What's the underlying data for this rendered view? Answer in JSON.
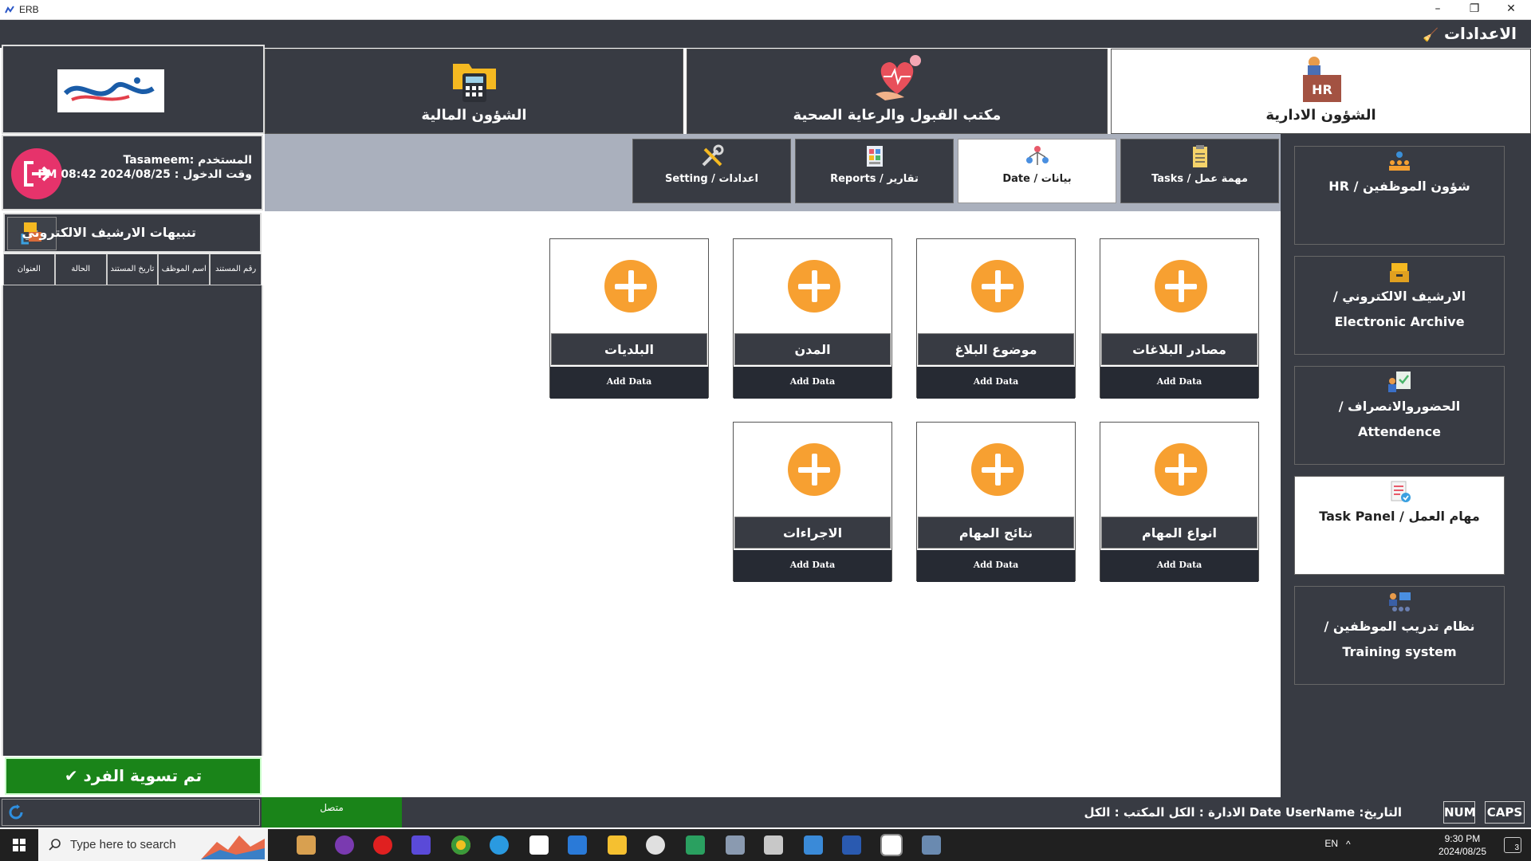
{
  "window": {
    "title": "ERB"
  },
  "settings_bar": {
    "label": "الاعدادات"
  },
  "modules": [
    {
      "label": "الشؤون الادارية",
      "icon": "hr-icon",
      "active": true
    },
    {
      "label": "مكتب القبول والرعاية الصحية",
      "icon": "health-care-icon",
      "active": false
    },
    {
      "label": "الشؤون المالية",
      "icon": "calculator-folder-icon",
      "active": false
    }
  ],
  "user": {
    "line1": "المستخدم :Tasameem",
    "line2": "وقت الدخول : 2024/08/25 PM 08:42"
  },
  "archive_alerts": {
    "title": "تنبيهات الارشيف الالكتروني",
    "columns": [
      "رقم المستند",
      "اسم الموظف",
      "تاريخ المستند",
      "الحالة",
      "العنوان"
    ]
  },
  "settle_button": "تم تسوية الفرد",
  "sub_tabs": [
    {
      "label": "مهمة عمل / Tasks",
      "icon": "clipboard-icon",
      "active": false
    },
    {
      "label": "بيانات / Date",
      "icon": "data-network-icon",
      "active": true
    },
    {
      "label": "تقارير / Reports",
      "icon": "report-icon",
      "active": false
    },
    {
      "label": "اعدادات / Setting",
      "icon": "tools-icon",
      "active": false
    }
  ],
  "cards_row1": [
    {
      "name": "مصادر البلاغات",
      "action": "Add Data"
    },
    {
      "name": "موضوع البلاغ",
      "action": "Add Data"
    },
    {
      "name": "المدن",
      "action": "Add Data"
    },
    {
      "name": "البلديات",
      "action": "Add Data"
    }
  ],
  "cards_row2": [
    {
      "name": "انواع المهام",
      "action": "Add Data"
    },
    {
      "name": "نتائج المهام",
      "action": "Add Data"
    },
    {
      "name": "الاجراءات",
      "action": "Add Data"
    }
  ],
  "right_nav": [
    {
      "label": "شؤون الموظفين / HR",
      "icon": "employees-icon",
      "active": false
    },
    {
      "label": "الارشيف الالكتروني / Electronic Archive",
      "icon": "archive-icon",
      "active": false
    },
    {
      "label": "الحضوروالانصراف / Attendence",
      "icon": "attendance-icon",
      "active": false
    },
    {
      "label": "مهام العمل / Task Panel",
      "icon": "task-panel-icon",
      "active": true
    },
    {
      "label": "نظام تدريب الموظفين / Training system",
      "icon": "training-icon",
      "active": false
    }
  ],
  "status": {
    "connected": "متصل",
    "info": "التاريخ: Date  UserName  الادارة : الكل المكتب : الكل",
    "num": "NUM",
    "caps": "CAPS"
  },
  "taskbar": {
    "search_placeholder": "Type here to search",
    "lang": "EN",
    "time": "9:30 PM",
    "date": "2024/08/25",
    "notifications": "3"
  },
  "colors": {
    "panel": "#383b43",
    "accent_orange": "#f7a031",
    "green": "#1a8419",
    "logout_pink": "#e6336b"
  }
}
